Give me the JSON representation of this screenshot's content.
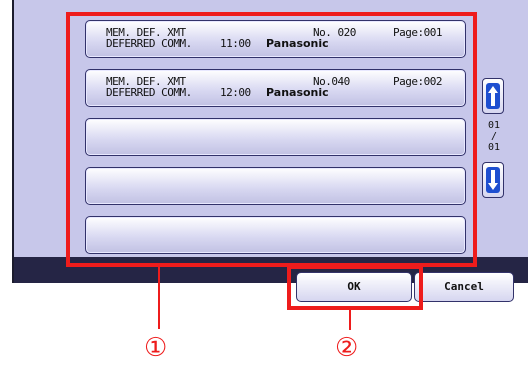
{
  "jobs": [
    {
      "line1": "MEM. DEF. XMT",
      "line2": "DEFERRED COMM.",
      "time": "11:00",
      "dest": "Panasonic",
      "number": "No. 020",
      "page": "Page:001"
    },
    {
      "line1": "MEM. DEF. XMT",
      "line2": "DEFERRED COMM.",
      "time": "12:00",
      "dest": "Panasonic",
      "number": "No.040",
      "page": "Page:002"
    }
  ],
  "pager": {
    "current": "01",
    "sep": "/",
    "total": "01"
  },
  "footer": {
    "ok_label": "OK",
    "cancel_label": "Cancel"
  },
  "callouts": {
    "one": "①",
    "two": "②"
  },
  "colors": {
    "panel": "#c7c7ea",
    "footer": "#252545",
    "callout": "#ee1c1c"
  },
  "icons": {
    "up": "arrow-up-icon",
    "down": "arrow-down-icon"
  }
}
